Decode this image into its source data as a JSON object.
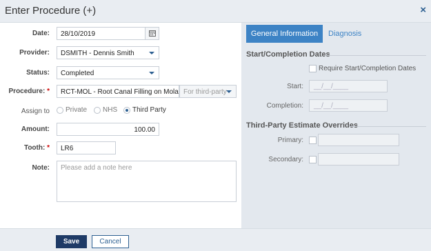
{
  "dialog": {
    "title": "Enter Procedure (+)",
    "close_glyph": "×"
  },
  "form": {
    "date": {
      "label": "Date:",
      "value": "28/10/2019"
    },
    "provider": {
      "label": "Provider:",
      "value": "DSMITH - Dennis Smith"
    },
    "status": {
      "label": "Status:",
      "value": "Completed"
    },
    "procedure": {
      "label": "Procedure:",
      "required_mark": "*",
      "value": "RCT-MOL - Root Canal Filling on Molar",
      "for_label": "For third-party"
    },
    "assign_to": {
      "label": "Assign to",
      "options": [
        "Private",
        "NHS",
        "Third Party"
      ],
      "selected": "Third Party"
    },
    "amount": {
      "label": "Amount:",
      "value": "100.00"
    },
    "tooth": {
      "label": "Tooth:",
      "required_mark": "*",
      "value": "LR6"
    },
    "note": {
      "label": "Note:",
      "placeholder": "Please add a note here"
    }
  },
  "panel": {
    "tabs": [
      {
        "label": "General Information",
        "active": true
      },
      {
        "label": "Diagnosis",
        "active": false
      }
    ],
    "dates_section": {
      "title": "Start/Completion Dates",
      "require_label": "Require Start/Completion Dates",
      "start_label": "Start:",
      "completion_label": "Completion:",
      "date_placeholder": "__/__/____"
    },
    "overrides_section": {
      "title": "Third-Party Estimate Overrides",
      "primary_label": "Primary:",
      "secondary_label": "Secondary:"
    }
  },
  "footer": {
    "save_label": "Save",
    "cancel_label": "Cancel"
  },
  "colors": {
    "accent": "#3d83c5",
    "primary_button": "#1e3a66",
    "panel_bg": "#e3e8ee",
    "required": "#cc0000"
  }
}
